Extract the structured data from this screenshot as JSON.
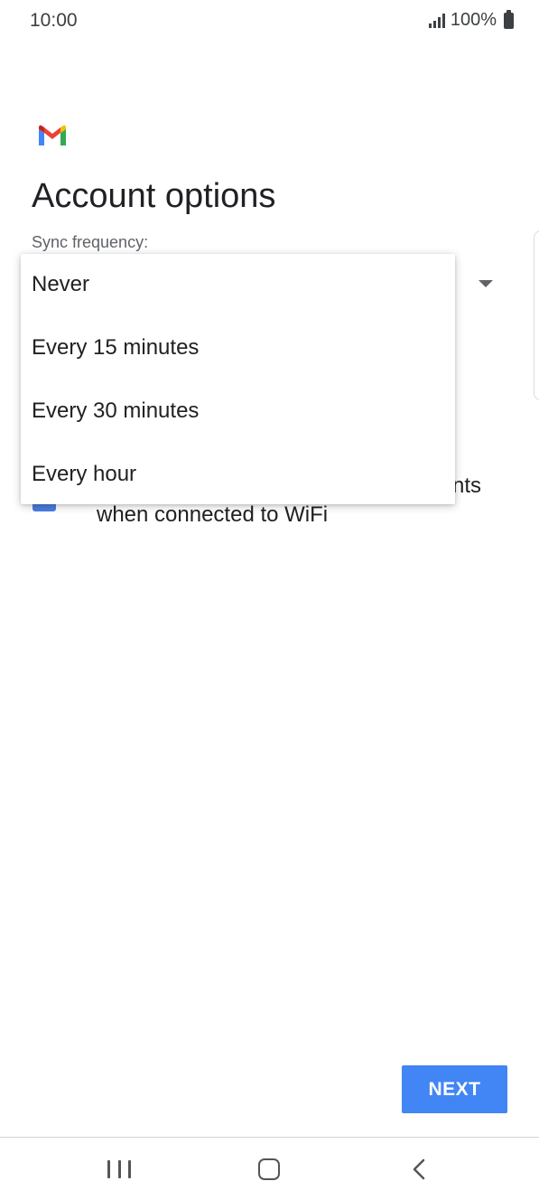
{
  "status_bar": {
    "time": "10:00",
    "battery_text": "100%",
    "icons": [
      "signal-icon",
      "battery-icon"
    ]
  },
  "app": {
    "logo_icon": "gmail-logo-icon",
    "title": "Account options"
  },
  "sync": {
    "label": "Sync frequency:",
    "dropdown_open": true,
    "options": [
      "Never",
      "Every 15 minutes",
      "Every 30 minutes",
      "Every hour"
    ]
  },
  "wifi_option": {
    "checked": true,
    "text_line1_visible": "nts",
    "text_line2": "when connected to WiFi"
  },
  "actions": {
    "next_label": "NEXT"
  },
  "nav": {
    "icons": [
      "recent-apps-icon",
      "home-icon",
      "back-icon"
    ]
  },
  "colors": {
    "accent": "#4285f4",
    "checkbox": "#4a7de0",
    "text_primary": "#202124",
    "text_secondary": "#5f6368"
  }
}
